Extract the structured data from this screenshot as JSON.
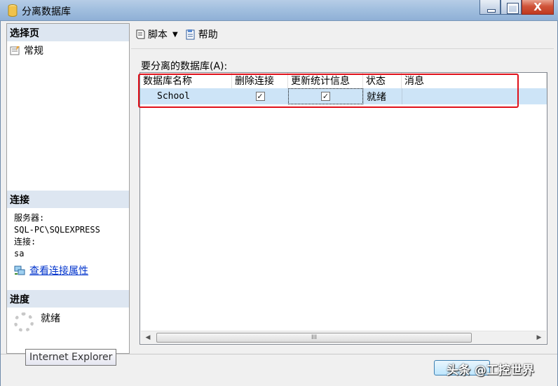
{
  "window": {
    "title": "分离数据库",
    "close_glyph": "X"
  },
  "left_pane": {
    "select_page_header": "选择页",
    "pages": [
      {
        "label": "常规"
      }
    ],
    "connection_header": "连接",
    "server_label": "服务器:",
    "server_value": "SQL-PC\\SQLEXPRESS",
    "connection_label": "连接:",
    "connection_value": "sa",
    "view_properties_link": "查看连接属性",
    "progress_header": "进度",
    "progress_status": "就绪"
  },
  "toolbar": {
    "script_label": "脚本",
    "help_label": "帮助"
  },
  "grid": {
    "label": "要分离的数据库(A):",
    "columns": [
      "数据库名称",
      "删除连接",
      "更新统计信息",
      "状态",
      "消息"
    ],
    "rows": [
      {
        "name": "School",
        "drop_connections": true,
        "update_statistics": true,
        "status": "就绪",
        "message": ""
      }
    ],
    "check_glyph": "✓",
    "scroll_grip": "III"
  },
  "tooltip": "Internet Explorer",
  "watermark": "头条 @工控世界",
  "colors": {
    "selection": "#cde4f7",
    "highlight_box": "#e0101a",
    "link": "#0033cc",
    "pane_header": "#dde6f1"
  }
}
